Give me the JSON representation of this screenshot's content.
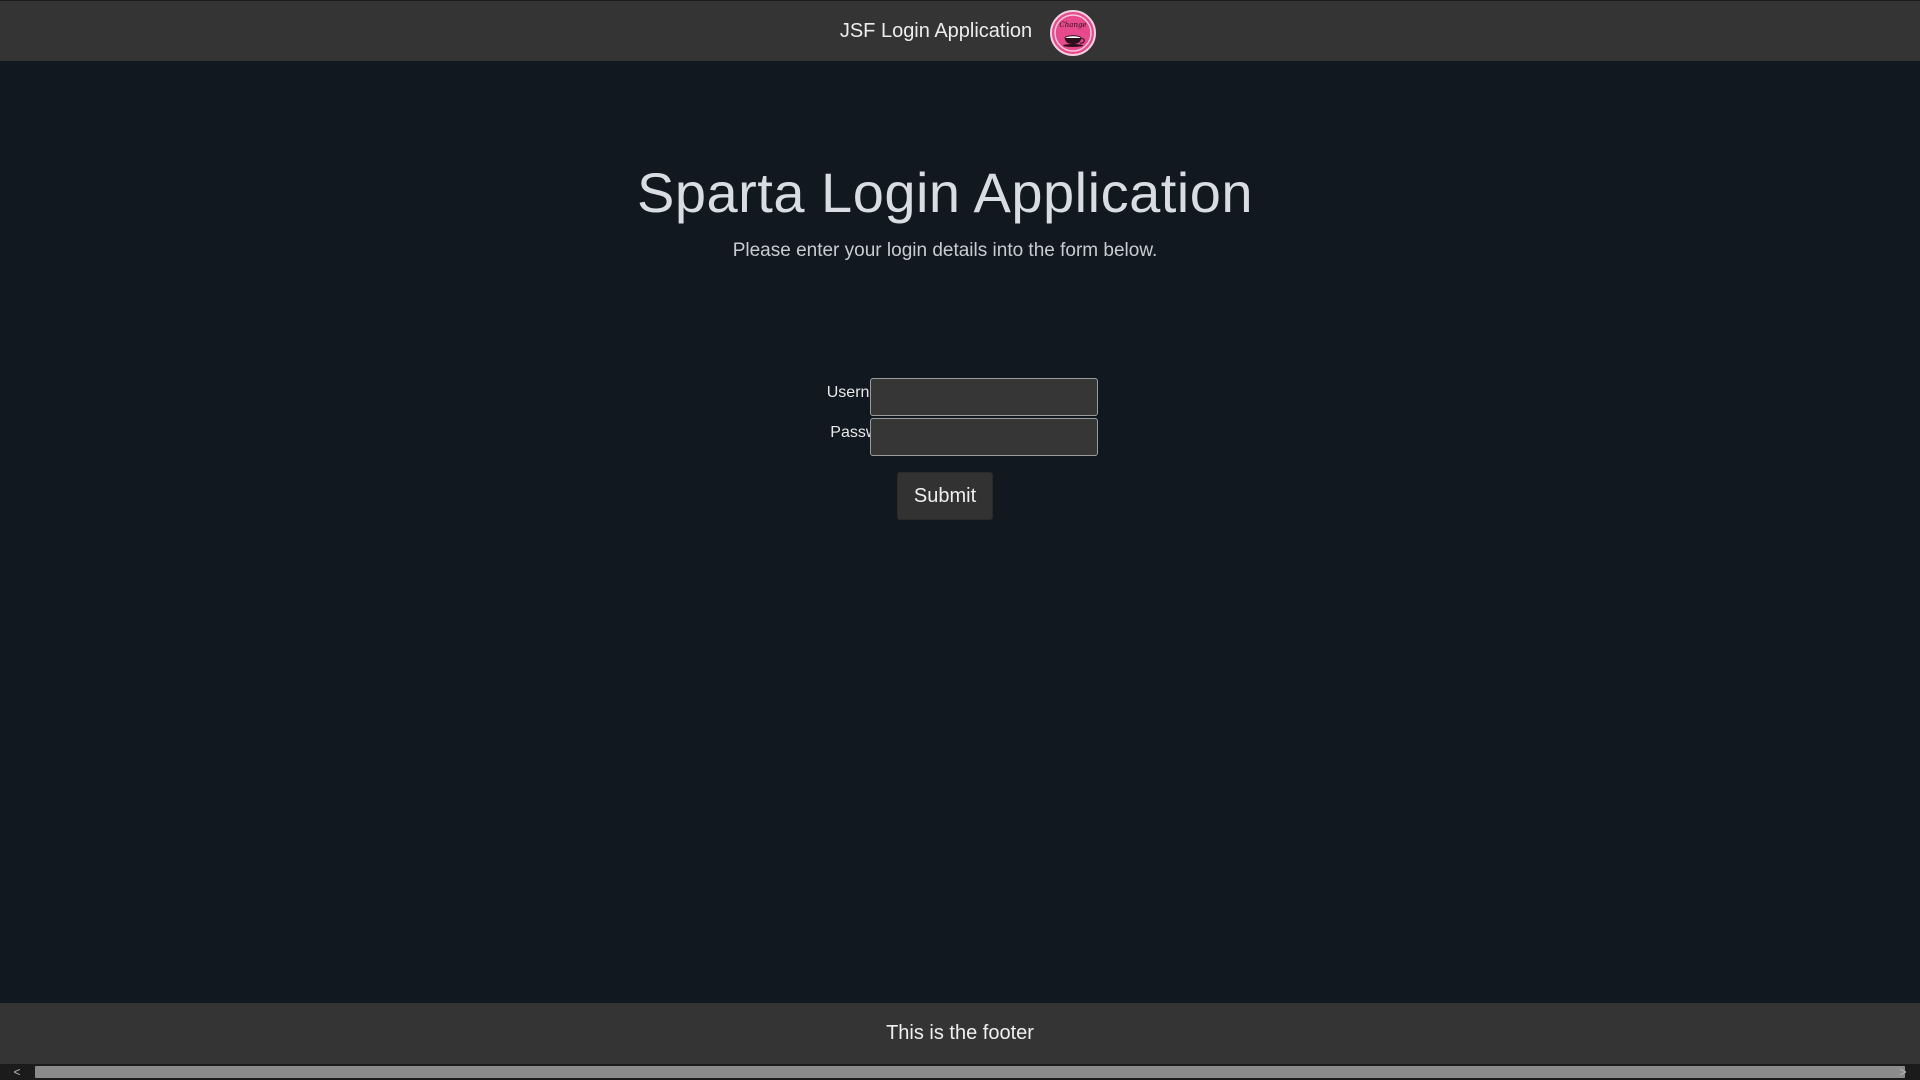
{
  "header": {
    "title": "JSF Login Application",
    "logo_icon": "coffee-cup-logo-icon",
    "logo_text": "Change",
    "logo_color": "#e64a8c"
  },
  "hero": {
    "title": "Sparta Login Application",
    "subtitle": "Please enter your login details into the form below."
  },
  "form": {
    "username_label": "Username:",
    "username_value": "",
    "password_label": "Password:",
    "password_value": "",
    "submit_label": "Submit"
  },
  "footer": {
    "text": "This is the footer"
  },
  "scrollbar": {
    "left_arrow": "<",
    "right_arrow": ">"
  },
  "colors": {
    "background": "#111820",
    "bar": "#343434"
  }
}
